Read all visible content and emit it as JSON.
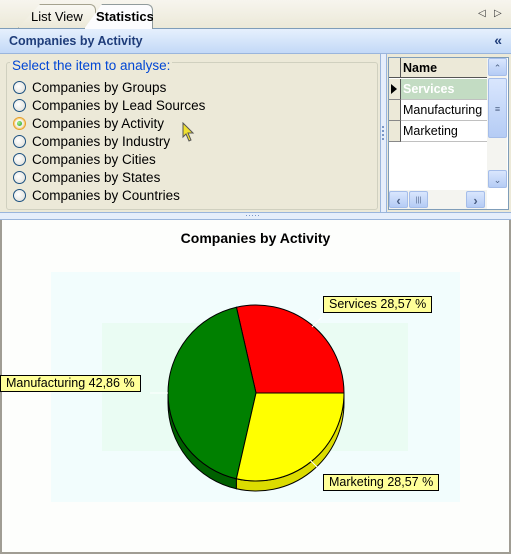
{
  "tabs": [
    {
      "label": "List View",
      "active": false
    },
    {
      "label": "Statistics",
      "active": true
    }
  ],
  "tab_nav": {
    "left_icon": "triangle-left-icon",
    "right_icon": "triangle-right-icon",
    "left_glyph": "◁",
    "right_glyph": "▷"
  },
  "header": {
    "title": "Companies by Activity",
    "collapse_glyph": "«"
  },
  "selector": {
    "legend": "Select the item to analyse:",
    "options": [
      {
        "label": "Companies by Groups",
        "checked": false
      },
      {
        "label": "Companies by Lead Sources",
        "checked": false
      },
      {
        "label": "Companies by Activity",
        "checked": true
      },
      {
        "label": "Companies by Industry",
        "checked": false
      },
      {
        "label": "Companies by Cities",
        "checked": false
      },
      {
        "label": "Companies by States",
        "checked": false
      },
      {
        "label": "Companies by Countries",
        "checked": false
      }
    ]
  },
  "grid": {
    "column_header": "Name",
    "rows": [
      {
        "name": "Services",
        "selected": true
      },
      {
        "name": "Manufacturing",
        "selected": false
      },
      {
        "name": "Marketing",
        "selected": false
      }
    ],
    "scroll_glyphs": {
      "up": "⌃",
      "down": "⌄",
      "left": "‹",
      "right": "›",
      "thumb": "≡",
      "hthumb": "|||"
    }
  },
  "chart_data": {
    "type": "pie",
    "title": "Companies by Activity",
    "three_d": true,
    "slices": [
      {
        "label": "Services",
        "value": 28.57,
        "display": "Services 28,57  %",
        "color": "#ff0000",
        "side_color": "#b00000"
      },
      {
        "label": "Marketing",
        "value": 28.57,
        "display": "Marketing 28,57  %",
        "color": "#ffff00",
        "side_color": "#dcdc00"
      },
      {
        "label": "Manufacturing",
        "value": 42.86,
        "display": "Manufacturing 42,86  %",
        "color": "#008000",
        "side_color": "#006000"
      }
    ],
    "start_angle_deg": 0,
    "direction": "counterclockwise-from-east: Services top-right, Manufacturing left, Marketing bottom-right",
    "legend": "none",
    "colors": {
      "plot_bg_outer": "#f2fdfd",
      "plot_bg_inner": "#eafcf3",
      "label_bg": "#ffff99"
    }
  }
}
